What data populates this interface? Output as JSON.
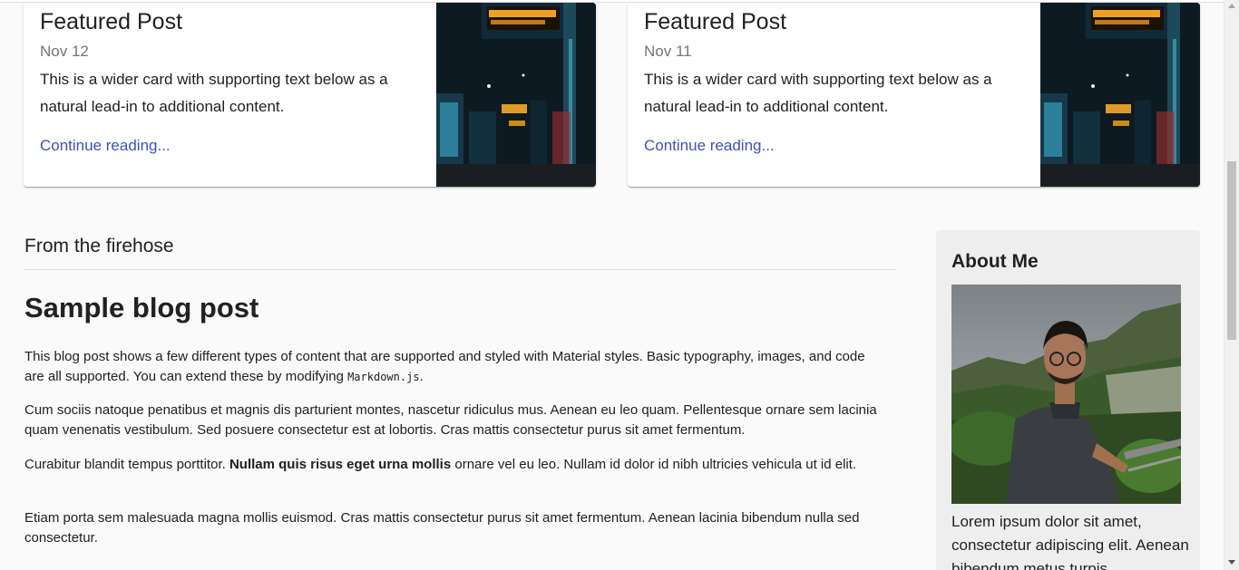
{
  "featured_posts": [
    {
      "title": "Featured Post",
      "date": "Nov 12",
      "text": "This is a wider card with supporting text below as a natural lead-in to additional content.",
      "link": "Continue reading..."
    },
    {
      "title": "Featured Post",
      "date": "Nov 11",
      "text": "This is a wider card with supporting text below as a natural lead-in to additional content.",
      "link": "Continue reading..."
    }
  ],
  "main": {
    "section_title": "From the firehose",
    "post_title": "Sample blog post",
    "p1_text": "This blog post shows a few different types of content that are supported and styled with Material styles. Basic typography, images, and code are all supported. You can extend these by modifying ",
    "p1_code": "Markdown.js",
    "p1_end": ".",
    "p2": "Cum sociis natoque penatibus et magnis dis parturient montes, nascetur ridiculus mus. Aenean eu leo quam. Pellentesque ornare sem lacinia quam venenatis vestibulum. Sed posuere consectetur est at lobortis. Cras mattis consectetur purus sit amet fermentum.",
    "p3_start": "Curabitur blandit tempus porttitor. ",
    "p3_bold": "Nullam quis risus eget urna mollis",
    "p3_end": " ornare vel eu leo. Nullam id dolor id nibh ultricies vehicula ut id elit.",
    "p4": "Etiam porta sem malesuada magna mollis euismod. Cras mattis consectetur purus sit amet fermentum. Aenean lacinia bibendum nulla sed consectetur."
  },
  "sidebar": {
    "title": "About Me",
    "text": "Lorem ipsum dolor sit amet, consectetur adipiscing elit. Aenean bibendum metus turpis"
  },
  "colors": {
    "link": "#3f51b5",
    "background": "#fafafa",
    "sidebar_bg": "#eeeeee"
  }
}
